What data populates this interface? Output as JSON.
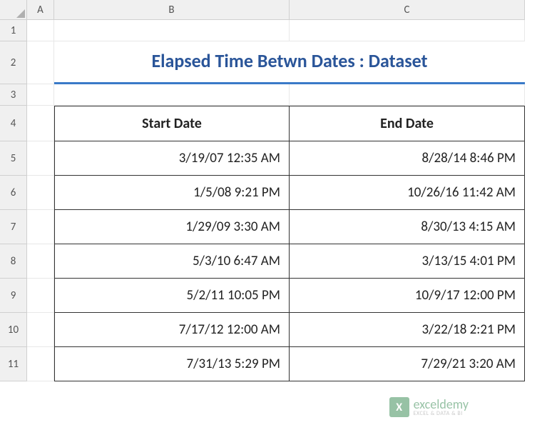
{
  "columns": [
    "A",
    "B",
    "C"
  ],
  "rows": [
    "1",
    "2",
    "3",
    "4",
    "5",
    "6",
    "7",
    "8",
    "9",
    "10",
    "11"
  ],
  "title": "Elapsed Time Betwn Dates : Dataset",
  "headers": {
    "start": "Start Date",
    "end": "End Date"
  },
  "chart_data": {
    "type": "table",
    "title": "Elapsed Time Betwn Dates : Dataset",
    "columns": [
      "Start Date",
      "End Date"
    ],
    "rows": [
      {
        "start": "3/19/07 12:35 AM",
        "end": "8/28/14 8:46 PM"
      },
      {
        "start": "1/5/08 9:21 PM",
        "end": "10/26/16 11:42 AM"
      },
      {
        "start": "1/29/09 3:30 AM",
        "end": "8/30/13 4:15 AM"
      },
      {
        "start": "5/3/10 6:47 AM",
        "end": "3/13/15 4:01 PM"
      },
      {
        "start": "5/2/11 10:05 PM",
        "end": "10/9/17 12:00 PM"
      },
      {
        "start": "7/17/12 12:00 AM",
        "end": "3/22/18 2:21 PM"
      },
      {
        "start": "7/31/13 5:29 PM",
        "end": "7/29/21 3:20 AM"
      }
    ]
  },
  "watermark": {
    "main": "exceldemy",
    "sub": "EXCEL & DATA & BI"
  }
}
